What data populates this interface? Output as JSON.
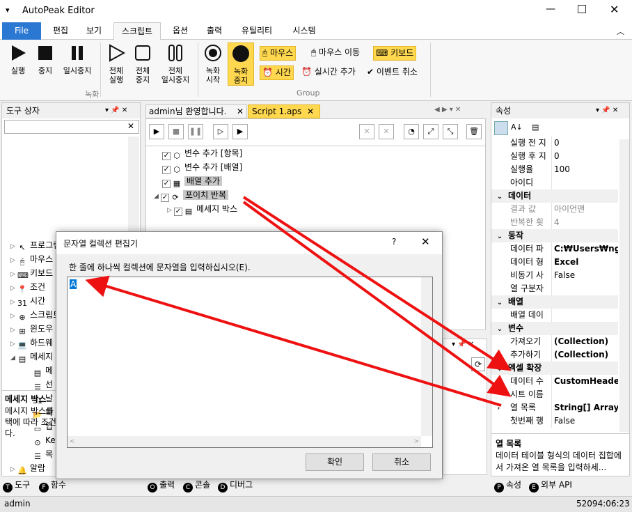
{
  "window": {
    "title": "AutoPeak Editor"
  },
  "ribbon_tabs": [
    "File",
    "편집",
    "보기",
    "스크립트",
    "옵션",
    "출력",
    "유틸리티",
    "시스템"
  ],
  "ribbon": {
    "run": "실행",
    "stop": "중지",
    "pause": "일시중지",
    "run_all": [
      "전체",
      "실행"
    ],
    "stop_all": [
      "전체",
      "중지"
    ],
    "pause_all": [
      "전체",
      "일시중지"
    ],
    "rec_start": [
      "녹화",
      "시작"
    ],
    "rec_stop": [
      "녹화",
      "중지"
    ],
    "mouse": "마우스",
    "mouse_move": "마우스 이동",
    "keyboard": "키보드",
    "time": "시간",
    "add_realtime": "실시간 추가",
    "cancel_event": "이벤트 취소",
    "group_record": "녹화",
    "group_group": "Group"
  },
  "toolbox": {
    "title": "도구 상자",
    "items": [
      "프로그램",
      "마우스",
      "키보드",
      "조건",
      "시간",
      "스크립트",
      "윈도우",
      "하드웨",
      "메세지"
    ],
    "sub_items": [
      "메",
      "선",
      "날",
      "파",
      "입",
      "Ke",
      "목"
    ],
    "alarm": "알람",
    "desc_title": "메세지 박스",
    "desc_text": "메시지 박스를 택에 따라 조건 다."
  },
  "doc_tabs": {
    "welcome": "admin님 환영합니다.",
    "script": "Script 1.aps"
  },
  "script_tree": [
    {
      "label": "변수 추가 [항목]"
    },
    {
      "label": "변수 추가 [배열]"
    },
    {
      "label": "배열 추가"
    },
    {
      "label": "포이치 반복"
    },
    {
      "label": "메세지 박스"
    }
  ],
  "properties": {
    "title": "속성",
    "rows_top": [
      {
        "k": "실행 전 지",
        "v": "0"
      },
      {
        "k": "실행 후 지",
        "v": "0"
      },
      {
        "k": "실행율",
        "v": "100"
      },
      {
        "k": "아이디",
        "v": ""
      }
    ],
    "cat_data": "데이터",
    "rows_data": [
      {
        "k": "결과 값",
        "v": "아이언맨"
      },
      {
        "k": "반복한 횟",
        "v": "4"
      }
    ],
    "cat_action": "동작",
    "rows_action": [
      {
        "k": "데이터 파",
        "v": "C:₩Users₩ngma"
      },
      {
        "k": "데이터 형",
        "v": "Excel"
      },
      {
        "k": "비동기 사",
        "v": "False"
      },
      {
        "k": "열 구분자",
        "v": ""
      }
    ],
    "cat_array": "배열",
    "rows_array": [
      {
        "k": "배열 데이",
        "v": ""
      }
    ],
    "cat_var": "변수",
    "rows_var": [
      {
        "k": "가져오기",
        "v": "(Collection)"
      },
      {
        "k": "추가하기",
        "v": "(Collection)"
      }
    ],
    "cat_excel": "엑셀 확장",
    "rows_excel": [
      {
        "k": "데이터 수",
        "v": "CustomHeaderC"
      },
      {
        "k": "시트 이름",
        "v": ""
      },
      {
        "k": "열 목록",
        "v": "String[] Array"
      },
      {
        "k": "첫번째 행",
        "v": "False"
      }
    ],
    "desc_title": "열 목록",
    "desc_text": "데이터 테이블 형식의 데이터 집합에서 가져온 열 목록을 입력하세..."
  },
  "bottom_tabs": {
    "left": [
      {
        "badge": "T",
        "label": "도구"
      },
      {
        "badge": "F",
        "label": "함수"
      }
    ],
    "center": [
      {
        "badge": "O",
        "label": "출력"
      },
      {
        "badge": "C",
        "label": "콘솔"
      },
      {
        "badge": "D",
        "label": "디버그"
      }
    ],
    "right": [
      {
        "badge": "P",
        "label": "속성"
      },
      {
        "badge": "E",
        "label": "외부 API"
      }
    ]
  },
  "status": {
    "user": "admin",
    "time": "52094:06:23"
  },
  "dialog": {
    "title": "문자열 컬렉션 편집기",
    "help": "?",
    "instruction": "한 줄에 하나씩 컬렉션에 문자열을 입력하십시오(E).",
    "text_value": "A",
    "ok": "확인",
    "cancel": "취소"
  },
  "colors": {
    "accent": "#2b78d3",
    "annotation": "#ee1111",
    "highlight": "#ffd84f"
  }
}
